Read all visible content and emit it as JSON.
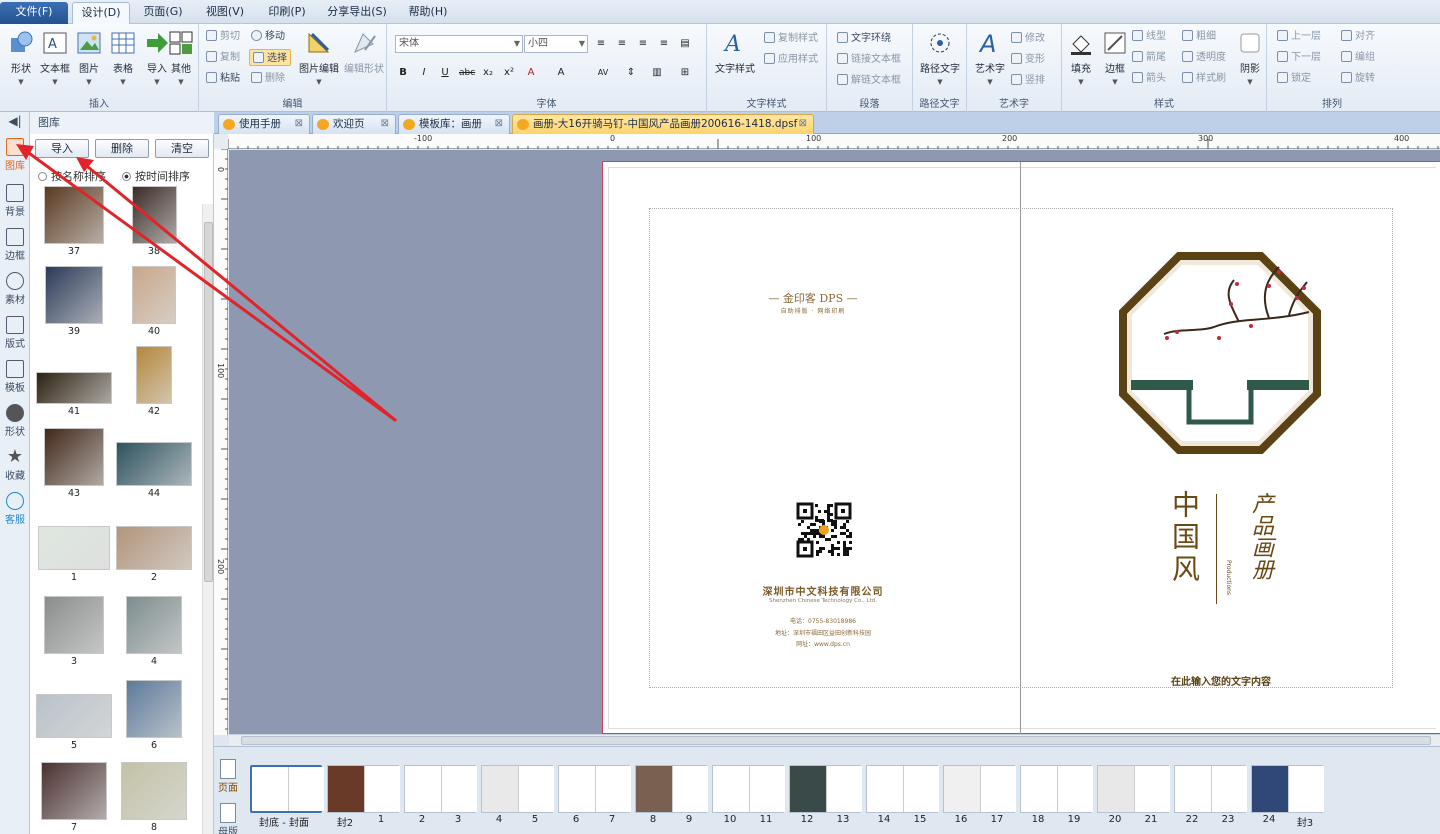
{
  "menu": {
    "file": "文件(F)",
    "design": "设计(D)",
    "page": "页面(G)",
    "view": "视图(V)",
    "print": "印刷(P)",
    "share": "分享导出(S)",
    "help": "帮助(H)"
  },
  "ribbon": {
    "insert": {
      "shape": "形状",
      "textbox": "文本框",
      "image": "图片",
      "table": "表格",
      "import": "导入",
      "other": "其他",
      "label": "插入"
    },
    "edit": {
      "cut": "剪切",
      "copy": "复制",
      "paste": "粘贴",
      "move": "移动",
      "select": "选择",
      "delete": "删除",
      "image_edit": "图片编辑",
      "edit_shape": "编辑形状",
      "label": "编辑"
    },
    "font": {
      "family": "宋体",
      "size": "小四",
      "label": "字体"
    },
    "textstyle": {
      "main": "文字样式",
      "copy": "复制样式",
      "apply": "应用样式",
      "label": "文字样式"
    },
    "para": {
      "wrap": "文字环绕",
      "link": "链接文本框",
      "unlink": "解链文本框",
      "label": "段落"
    },
    "path": {
      "main": "路径文字",
      "label": "路径文字"
    },
    "art": {
      "main": "艺术字",
      "modify": "修改",
      "transform": "变形",
      "vertical": "竖排",
      "label": "艺术字"
    },
    "style": {
      "fill": "填充",
      "border": "边框",
      "line": "线型",
      "thickness": "粗细",
      "endcap": "箭尾",
      "transparency": "透明度",
      "arrow": "箭头",
      "brush": "样式刷",
      "shadow": "阴影",
      "label": "样式"
    },
    "arrange": {
      "up": "上一层",
      "align": "对齐",
      "down": "下一层",
      "group": "编组",
      "lock": "锁定",
      "rotate": "旋转",
      "label": "排列"
    }
  },
  "sidebar": {
    "items": [
      "图库",
      "背景",
      "边框",
      "素材",
      "版式",
      "模板",
      "形状",
      "收藏",
      "客服"
    ]
  },
  "gallery": {
    "title": "图库",
    "import": "导入",
    "delete": "删除",
    "clear": "清空",
    "sort_name": "按名称排序",
    "sort_time": "按时间排序",
    "items": [
      {
        "label": "37",
        "color": "#5a3a20"
      },
      {
        "label": "38",
        "color": "#3b2c26"
      },
      {
        "label": "39",
        "color": "#2c3a58"
      },
      {
        "label": "40",
        "color": "#c8a78a"
      },
      {
        "label": "41",
        "color": "#2d2212"
      },
      {
        "label": "42",
        "color": "#b5873a"
      },
      {
        "label": "43",
        "color": "#412818"
      },
      {
        "label": "44",
        "color": "#2e5360"
      },
      {
        "label": "1",
        "color": "#dfe7e0"
      },
      {
        "label": "2",
        "color": "#b2957b"
      },
      {
        "label": "3",
        "color": "#8b8d8d"
      },
      {
        "label": "4",
        "color": "#7e8d8e"
      },
      {
        "label": "5",
        "color": "#b9c2c9"
      },
      {
        "label": "6",
        "color": "#5d7a9a"
      },
      {
        "label": "7",
        "color": "#4a3030"
      },
      {
        "label": "8",
        "color": "#c3c2a6"
      }
    ]
  },
  "tabs": [
    "使用手册",
    "欢迎页",
    "模板库：画册",
    "画册-大16开骑马钉-中国风产品画册200616-1418.dpsf"
  ],
  "ruler": {
    "h": [
      "-100",
      "0",
      "100",
      "200",
      "300",
      "400"
    ],
    "v": [
      "0",
      "100",
      "200"
    ]
  },
  "doc": {
    "brand": "— 金印客 DPS —",
    "brand_sub": "自助排版 · 网络印刷",
    "company": "深圳市中文科技有限公司",
    "company_en": "Shenzhen Chinese Technology Co., Ltd.",
    "phone": "电话：0755-83018986",
    "address": "地址：深圳市福田区益田创新科技园",
    "web": "网址：www.dps.cn",
    "title_left": "中国风",
    "title_right": "产品画册",
    "title_en": "Productions",
    "prompt": "在此输入您的文字内容"
  },
  "pages": {
    "side": [
      "页面",
      "母版"
    ],
    "items": [
      "封底 - 封面",
      "封2",
      "1",
      "2",
      "3",
      "4",
      "5",
      "6",
      "7",
      "8",
      "9",
      "10",
      "11",
      "12",
      "13",
      "14",
      "15",
      "16",
      "17",
      "18",
      "19",
      "20",
      "21",
      "22",
      "23",
      "24",
      "封3"
    ]
  }
}
